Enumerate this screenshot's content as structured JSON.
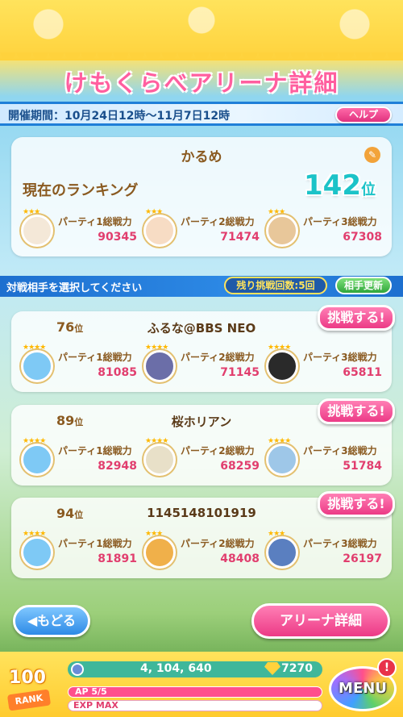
{
  "header": {
    "title": "けもくらべアリーナ詳細"
  },
  "period": {
    "text": "開催期間：10月24日12時〜11月7日12時",
    "help_label": "ヘルプ"
  },
  "player": {
    "name": "かるめ",
    "rank_label": "現在のランキング",
    "rank_value": "142",
    "rank_unit": "位",
    "parties": [
      {
        "label": "パーティ1総戦力",
        "power": "90345",
        "stars": "★★★",
        "color": "#f4e8d8"
      },
      {
        "label": "パーティ2総戦力",
        "power": "71474",
        "stars": "★★★",
        "color": "#f7dcc4"
      },
      {
        "label": "パーティ3総戦力",
        "power": "67308",
        "stars": "★★★",
        "color": "#e8c79a"
      }
    ]
  },
  "selection": {
    "prompt": "対戦相手を選択してください",
    "remaining": "残り挑戦回数:5回",
    "refresh_label": "相手更新"
  },
  "opponents": [
    {
      "rank": "76",
      "rank_unit": "位",
      "name": "ふるな@BBS NEO",
      "challenge_label": "挑戦する!",
      "parties": [
        {
          "label": "パーティ1総戦力",
          "power": "81085",
          "stars": "★★★★",
          "color": "#7ec9f5"
        },
        {
          "label": "パーティ2総戦力",
          "power": "71145",
          "stars": "★★★★",
          "color": "#6b6ea8"
        },
        {
          "label": "パーティ3総戦力",
          "power": "65811",
          "stars": "★★★★",
          "color": "#2a2a2a"
        }
      ]
    },
    {
      "rank": "89",
      "rank_unit": "位",
      "name": "桜ホリアン",
      "challenge_label": "挑戦する!",
      "parties": [
        {
          "label": "パーティ1総戦力",
          "power": "82948",
          "stars": "★★★★",
          "color": "#7ec9f5"
        },
        {
          "label": "パーティ2総戦力",
          "power": "68259",
          "stars": "★★★★",
          "color": "#e8e0c8"
        },
        {
          "label": "パーティ3総戦力",
          "power": "51784",
          "stars": "★★★★",
          "color": "#9ec7e8"
        }
      ]
    },
    {
      "rank": "94",
      "rank_unit": "位",
      "name": "1145148101919",
      "challenge_label": "挑戦する!",
      "parties": [
        {
          "label": "パーティ1総戦力",
          "power": "81891",
          "stars": "★★★★",
          "color": "#7ec9f5"
        },
        {
          "label": "パーティ2総戦力",
          "power": "48408",
          "stars": "★★★",
          "color": "#f0b04a"
        },
        {
          "label": "パーティ3総戦力",
          "power": "26197",
          "stars": "★★★",
          "color": "#5a7fc0"
        }
      ]
    }
  ],
  "nav": {
    "back_label": "◀もどる",
    "arena_detail_label": "アリーナ詳細"
  },
  "footer": {
    "rank_number": "100",
    "rank_word": "RANK",
    "coins": "4, 104, 640",
    "gems": "7270",
    "ap_text": "AP 5/5",
    "ap_fraction": 1.0,
    "exp_text": "EXP MAX",
    "menu_label": "MENU",
    "menu_alert": "!"
  }
}
